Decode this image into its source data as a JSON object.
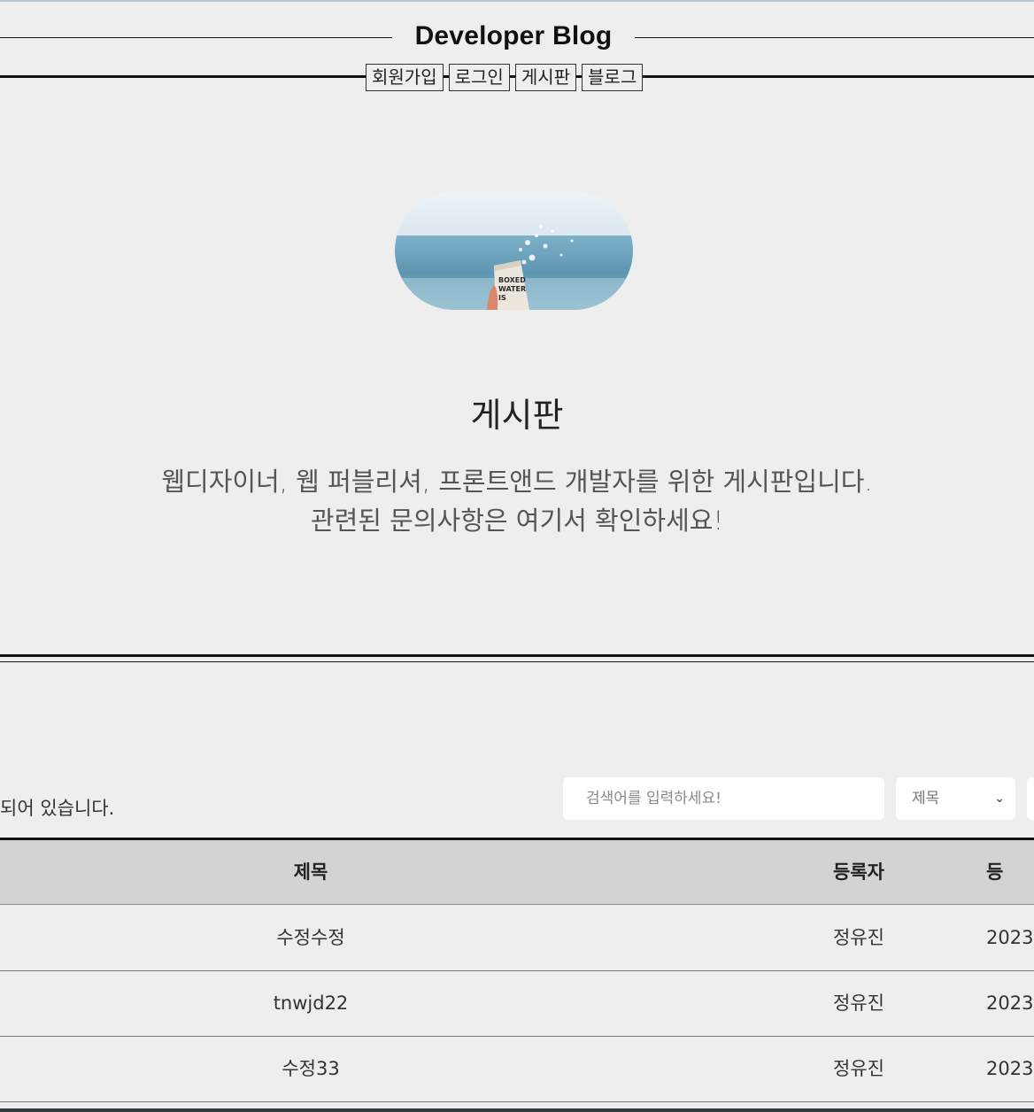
{
  "header": {
    "site_title": "Developer Blog",
    "nav": [
      {
        "label": "회원가입"
      },
      {
        "label": "로그인"
      },
      {
        "label": "게시판"
      },
      {
        "label": "블로그"
      }
    ]
  },
  "hero": {
    "image_text": [
      "BOXED",
      "WATER",
      "IS"
    ],
    "title": "게시판",
    "description_line1": "웹디자이너, 웹 퍼블리셔, 프론트앤드 개발자를 위한 게시판입니다.",
    "description_line2": "관련된 문의사항은 여기서 확인하세요!"
  },
  "board": {
    "count_text": "되어 있습니다.",
    "search": {
      "placeholder": "검색어를 입력하세요!",
      "select_value": "제목"
    },
    "columns": {
      "title": "제목",
      "author": "등록자",
      "date": "등"
    },
    "rows": [
      {
        "title": "수정수정",
        "author": "정유진",
        "date": "2023"
      },
      {
        "title": "tnwjd22",
        "author": "정유진",
        "date": "2023"
      },
      {
        "title": "수정33",
        "author": "정유진",
        "date": "2023"
      }
    ]
  }
}
